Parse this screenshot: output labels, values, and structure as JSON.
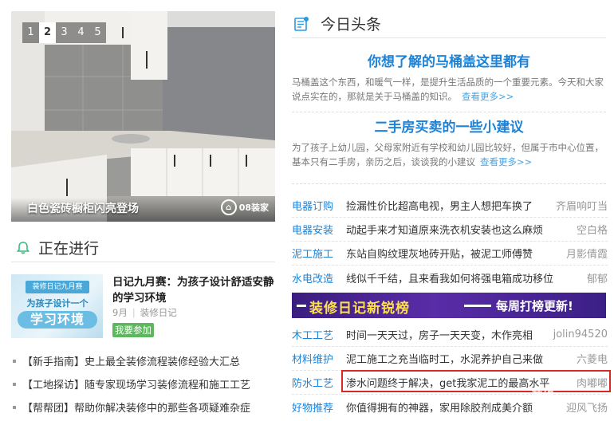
{
  "slider": {
    "dots": [
      "1",
      "2",
      "3",
      "4",
      "5"
    ],
    "active_index": 1,
    "caption": "白色瓷砖橱柜闪亮登场",
    "watermark_text": "08装家"
  },
  "ongoing": {
    "title": "正在进行",
    "card": {
      "ribbon": "装修日记九月赛",
      "subtitle": "为孩子设计一个",
      "big": "学习环境"
    },
    "item_title": "日记九月赛：为孩子设计舒适安静的学习环境",
    "month": "9月",
    "category": "装修日记",
    "join_button": "我要参加",
    "news": [
      "【新手指南】史上最全装修流程装修经验大汇总",
      "【工地探访】随专家现场学习装修流程和施工工艺",
      "【帮帮团】帮助你解决装修中的那些各项疑难杂症"
    ]
  },
  "headlines": {
    "title": "今日头条",
    "features": [
      {
        "title": "你想了解的马桶盖这里都有",
        "text": "马桶盖这个东西，和暖气一样，是提升生活品质的一个重要元素。今天和大家说点实在的，那就是关于马桶盖的知识。",
        "more": "查看更多>>"
      },
      {
        "title": "二手房买卖的一些小建议",
        "text": "为了孩子上幼儿园，父母家附近有学校和幼儿园比较好，但属于市中心位置，基本只有二手房，亲历之后，谈谈我的小建议",
        "more": "查看更多>>"
      }
    ],
    "rows_top": [
      {
        "tag": "电器订购",
        "text": "捡漏性价比超高电视，男主人想把车换了",
        "author": "齐眉响叮当"
      },
      {
        "tag": "电器安装",
        "text": "动起手来才知道原来洗衣机安装也这么麻烦",
        "author": "空白格"
      },
      {
        "tag": "泥工施工",
        "text": "东站自购纹理灰地砖开贴，被泥工师傅赞",
        "author": "月影倩霞"
      },
      {
        "tag": "水电改造",
        "text": "线似千千结，且来看我如何将强电箱成功移位",
        "author": "郁郁"
      }
    ],
    "banner": {
      "left": "装修日记新锐榜",
      "right": "每周打榜更新!"
    },
    "rows_bottom": [
      {
        "tag": "木工工艺",
        "text": "时间一天天过，房子一天天变，木作亮相",
        "author": "jolin94520"
      },
      {
        "tag": "材料维护",
        "text": "泥工施工之充当临时工，水泥养护自己来做",
        "author": "六菱电"
      },
      {
        "tag": "防水工艺",
        "text": "渗水问题终于解决，get我家泥工的最高水平",
        "author": "肉嘟嘟"
      },
      {
        "tag": "好物推荐",
        "text": "你值得拥有的神器，家用除胶剂成美介额",
        "author": "迎风飞扬"
      }
    ],
    "overlay_watermark": "⊙ 装修"
  },
  "colors": {
    "accent_blue": "#1d83d9",
    "join_green": "#5cb85c",
    "banner_purple": "#4a2598",
    "highlight_red": "#d42a2a"
  }
}
